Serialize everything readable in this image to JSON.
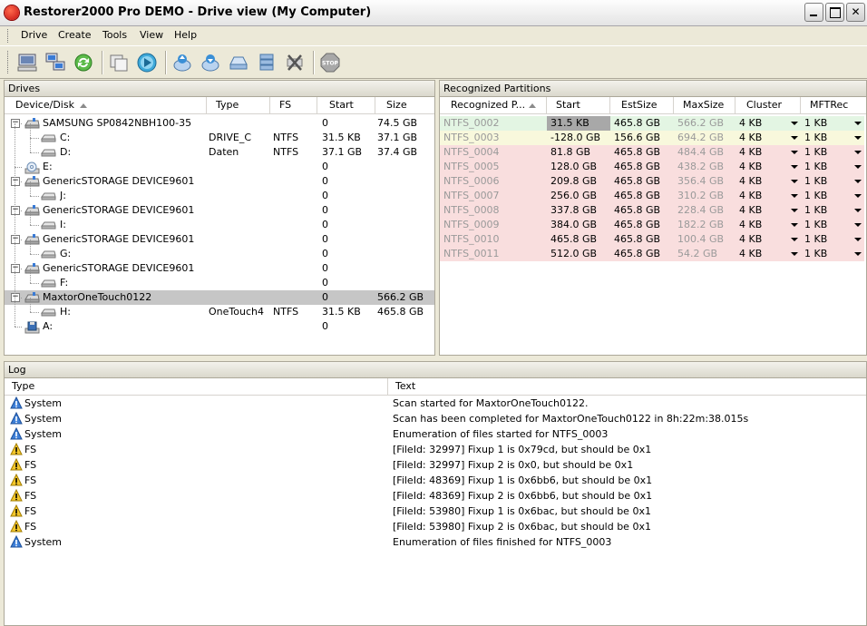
{
  "window": {
    "title": "Restorer2000 Pro DEMO - Drive view (My Computer)"
  },
  "menu": [
    "Drive",
    "Create",
    "Tools",
    "View",
    "Help"
  ],
  "toolbar": {
    "stop_label": "STOP"
  },
  "drives": {
    "panel_title": "Drives",
    "columns": [
      "Device/Disk",
      "Type",
      "FS",
      "Start",
      "Size"
    ],
    "rows": [
      {
        "name": "SAMSUNG SP0842NBH100-35",
        "type": "",
        "fs": "",
        "start": "0",
        "size": "74.5 GB",
        "level": 0,
        "icon": "disk"
      },
      {
        "name": "C:",
        "type": "DRIVE_C",
        "fs": "NTFS",
        "start": "31.5 KB",
        "size": "37.1 GB",
        "level": 1,
        "icon": "partition"
      },
      {
        "name": "D:",
        "type": "Daten",
        "fs": "NTFS",
        "start": "37.1 GB",
        "size": "37.4 GB",
        "level": 1,
        "icon": "partition"
      },
      {
        "name": "E:",
        "type": "",
        "fs": "",
        "start": "0",
        "size": "",
        "level": 0,
        "icon": "cdrom"
      },
      {
        "name": "GenericSTORAGE DEVICE9601",
        "type": "",
        "fs": "",
        "start": "0",
        "size": "",
        "level": 0,
        "icon": "disk"
      },
      {
        "name": "J:",
        "type": "",
        "fs": "",
        "start": "0",
        "size": "",
        "level": 1,
        "icon": "partition"
      },
      {
        "name": "GenericSTORAGE DEVICE9601",
        "type": "",
        "fs": "",
        "start": "0",
        "size": "",
        "level": 0,
        "icon": "disk"
      },
      {
        "name": "I:",
        "type": "",
        "fs": "",
        "start": "0",
        "size": "",
        "level": 1,
        "icon": "partition"
      },
      {
        "name": "GenericSTORAGE DEVICE9601",
        "type": "",
        "fs": "",
        "start": "0",
        "size": "",
        "level": 0,
        "icon": "disk"
      },
      {
        "name": "G:",
        "type": "",
        "fs": "",
        "start": "0",
        "size": "",
        "level": 1,
        "icon": "partition"
      },
      {
        "name": "GenericSTORAGE DEVICE9601",
        "type": "",
        "fs": "",
        "start": "0",
        "size": "",
        "level": 0,
        "icon": "disk"
      },
      {
        "name": "F:",
        "type": "",
        "fs": "",
        "start": "0",
        "size": "",
        "level": 1,
        "icon": "partition"
      },
      {
        "name": "MaxtorOneTouch0122",
        "type": "",
        "fs": "",
        "start": "0",
        "size": "566.2 GB",
        "level": 0,
        "icon": "disk",
        "selected": true
      },
      {
        "name": "H:",
        "type": "OneTouch4",
        "fs": "NTFS",
        "start": "31.5 KB",
        "size": "465.8 GB",
        "level": 1,
        "icon": "partition"
      },
      {
        "name": "A:",
        "type": "",
        "fs": "",
        "start": "0",
        "size": "",
        "level": 0,
        "icon": "floppy"
      }
    ]
  },
  "partitions": {
    "panel_title": "Recognized Partitions",
    "columns": [
      "Recognized P...",
      "Start",
      "EstSize",
      "MaxSize",
      "Cluster",
      "MFTRec"
    ],
    "rows": [
      {
        "name": "NTFS_0002",
        "start": "31.5 KB",
        "estsize": "465.8 GB",
        "maxsize": "566.2 GB",
        "cluster": "4 KB",
        "mftrec": "1 KB",
        "color": "#e3f5e3"
      },
      {
        "name": "NTFS_0003",
        "start": "-128.0 GB",
        "estsize": "156.6 GB",
        "maxsize": "694.2 GB",
        "cluster": "4 KB",
        "mftrec": "1 KB",
        "color": "#f8f8dc"
      },
      {
        "name": "NTFS_0004",
        "start": "81.8 GB",
        "estsize": "465.8 GB",
        "maxsize": "484.4 GB",
        "cluster": "4 KB",
        "mftrec": "1 KB",
        "color": "#f9dede"
      },
      {
        "name": "NTFS_0005",
        "start": "128.0 GB",
        "estsize": "465.8 GB",
        "maxsize": "438.2 GB",
        "cluster": "4 KB",
        "mftrec": "1 KB",
        "color": "#f9dede"
      },
      {
        "name": "NTFS_0006",
        "start": "209.8 GB",
        "estsize": "465.8 GB",
        "maxsize": "356.4 GB",
        "cluster": "4 KB",
        "mftrec": "1 KB",
        "color": "#f9dede"
      },
      {
        "name": "NTFS_0007",
        "start": "256.0 GB",
        "estsize": "465.8 GB",
        "maxsize": "310.2 GB",
        "cluster": "4 KB",
        "mftrec": "1 KB",
        "color": "#f9dede"
      },
      {
        "name": "NTFS_0008",
        "start": "337.8 GB",
        "estsize": "465.8 GB",
        "maxsize": "228.4 GB",
        "cluster": "4 KB",
        "mftrec": "1 KB",
        "color": "#f9dede"
      },
      {
        "name": "NTFS_0009",
        "start": "384.0 GB",
        "estsize": "465.8 GB",
        "maxsize": "182.2 GB",
        "cluster": "4 KB",
        "mftrec": "1 KB",
        "color": "#f9dede"
      },
      {
        "name": "NTFS_0010",
        "start": "465.8 GB",
        "estsize": "465.8 GB",
        "maxsize": "100.4 GB",
        "cluster": "4 KB",
        "mftrec": "1 KB",
        "color": "#f9dede"
      },
      {
        "name": "NTFS_0011",
        "start": "512.0 GB",
        "estsize": "465.8 GB",
        "maxsize": "54.2 GB",
        "cluster": "4 KB",
        "mftrec": "1 KB",
        "color": "#f9dede"
      }
    ]
  },
  "log": {
    "panel_title": "Log",
    "columns": [
      "Type",
      "Text"
    ],
    "rows": [
      {
        "type": "System",
        "text": "Scan started for MaxtorOneTouch0122.",
        "icon": "info"
      },
      {
        "type": "System",
        "text": "Scan has been completed for MaxtorOneTouch0122 in 8h:22m:38.015s",
        "icon": "info"
      },
      {
        "type": "System",
        "text": "Enumeration of files started for NTFS_0003",
        "icon": "info"
      },
      {
        "type": "FS",
        "text": "[FileId: 32997] Fixup 1 is 0x79cd, but should be 0x1",
        "icon": "warning"
      },
      {
        "type": "FS",
        "text": "[FileId: 32997] Fixup 2 is 0x0, but should be 0x1",
        "icon": "warning"
      },
      {
        "type": "FS",
        "text": "[FileId: 48369] Fixup 1 is 0x6bb6, but should be 0x1",
        "icon": "warning"
      },
      {
        "type": "FS",
        "text": "[FileId: 48369] Fixup 2 is 0x6bb6, but should be 0x1",
        "icon": "warning"
      },
      {
        "type": "FS",
        "text": "[FileId: 53980] Fixup 1 is 0x6bac, but should be 0x1",
        "icon": "warning"
      },
      {
        "type": "FS",
        "text": "[FileId: 53980] Fixup 2 is 0x6bac, but should be 0x1",
        "icon": "warning"
      },
      {
        "type": "System",
        "text": "Enumeration of files finished for NTFS_0003",
        "icon": "info"
      }
    ]
  }
}
